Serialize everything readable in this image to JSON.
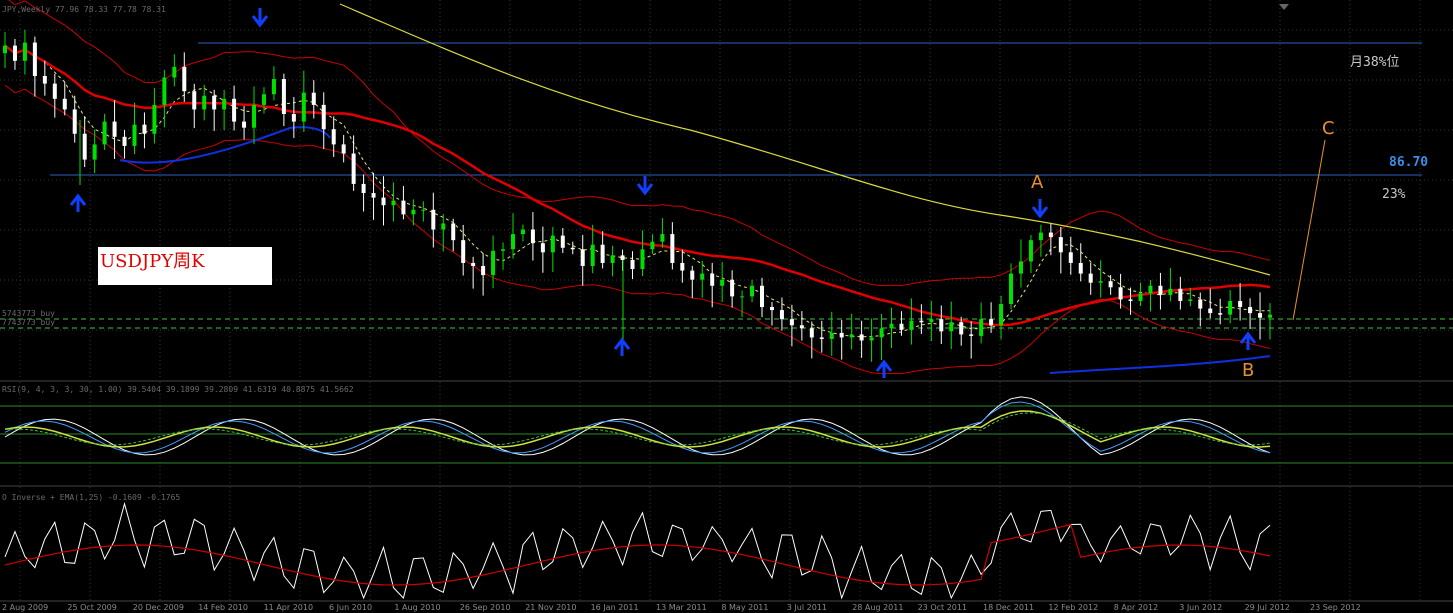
{
  "window": {
    "symbol_header": "JPY,Weekly  77.96 78.33 77.78 78.31"
  },
  "panes": {
    "main": {
      "level_label_1": "5743773 buy",
      "level_label_2": "7743773 buy"
    },
    "rsi": {
      "label": "RSI(9, 4, 3, 3, 30, 1.00) 39.5404 39.1899 39.2809 41.6319 40.8875 41.5662"
    },
    "osc": {
      "label": "O Inverse + EMA(1,25) -0.1609 -0.1765"
    }
  },
  "title_box": "USDJPY周K",
  "annotations": {
    "A": "A",
    "B": "B",
    "C": "C",
    "level_38": "月38%位",
    "level_8670": "86.70",
    "level_23": "23%"
  },
  "colors": {
    "bull": "#00e000",
    "bear": "#ffffff",
    "ma_red": "#e00000",
    "ma_blue": "#1030e0",
    "ma_yellow": "#d8d840",
    "band": "#cc0000",
    "level_line": "#3060c0",
    "dashed_green": "#40c040",
    "arrow": "#1040ff",
    "anno": "#e8902a"
  },
  "chart_data": [
    {
      "type": "candlestick",
      "title": "",
      "xlabel": "",
      "ylabel": "",
      "x_ticks": [
        "2 Aug 2009",
        "25 Oct 2009",
        "20 Dec 2009",
        "14 Feb 2010",
        "11 Apr 2010",
        "6 Jun 2010",
        "1 Aug 2010",
        "26 Sep 2010",
        "21 Nov 2010",
        "16 Jan 2011",
        "13 Mar 2011",
        "8 May 2011",
        "3 Jul 2011",
        "28 Aug 2011",
        "23 Oct 2011",
        "18 Dec 2011",
        "12 Feb 2012",
        "8 Apr 2012",
        "3 Jun 2012",
        "29 Jul 2012",
        "23 Sep 2012"
      ],
      "close": [
        96,
        95,
        96.2,
        94,
        93.5,
        92.5,
        91.8,
        90.2,
        88.5,
        89.5,
        91,
        90,
        89.4,
        90.8,
        90.2,
        92.1,
        93.9,
        94.6,
        93,
        91.8,
        92.7,
        91.8,
        92.5,
        91,
        90.6,
        92.1,
        92.8,
        93.8,
        91.5,
        91,
        92.9,
        92.1,
        90.5,
        89.5,
        88.9,
        86.9,
        86.3,
        86,
        85.5,
        85.8,
        84.9,
        85.2,
        85.2,
        83.9,
        84.3,
        83.2,
        81.7,
        81.5,
        80.9,
        82.5,
        82.6,
        83.6,
        83.9,
        83,
        82.4,
        83.5,
        82.7,
        82.6,
        81.5,
        82.9,
        81.7,
        82.2,
        81.9,
        81.3,
        82.6,
        83.1,
        83.6,
        81.7,
        81.2,
        80.6,
        81,
        80.2,
        80.6,
        79.5,
        79.5,
        80.2,
        78.8,
        78.6,
        78,
        77.6,
        77.4,
        76.8,
        76.7,
        77.1,
        76.8,
        77,
        76.6,
        76.8,
        77.4,
        77.7,
        77.3,
        77.9,
        77.8,
        78,
        77.2,
        77.8,
        77,
        76.9,
        78,
        77.6,
        79,
        81,
        81.8,
        83.2,
        83.7,
        83.4,
        82.4,
        81.7,
        81,
        80.4,
        80.5,
        80.1,
        79.3,
        79.2,
        79.7,
        80.2,
        79.6,
        80,
        79.2,
        79.3,
        78.7,
        78.4,
        78.3,
        79.2,
        78.8,
        78.4,
        78.1,
        78.3
      ],
      "open": [
        95.5,
        96,
        95,
        96.2,
        94,
        93.5,
        92.5,
        91.8,
        90.2,
        88.5,
        89.5,
        91,
        90,
        89.4,
        90.8,
        90.2,
        92.1,
        93.9,
        94.6,
        93,
        91.8,
        92.7,
        91.8,
        92.5,
        91,
        90.6,
        92.1,
        92.8,
        93.8,
        91.5,
        91,
        92.9,
        92.1,
        90.5,
        89.5,
        88.9,
        86.9,
        86.3,
        86,
        85.5,
        85.8,
        84.9,
        85.2,
        85.2,
        83.9,
        84.3,
        83.2,
        81.7,
        81.5,
        80.9,
        82.5,
        82.6,
        83.6,
        83.9,
        83,
        82.4,
        83.5,
        82.7,
        82.6,
        81.5,
        82.9,
        81.7,
        82.2,
        81.9,
        81.3,
        82.6,
        83.1,
        83.6,
        81.7,
        81.2,
        80.6,
        81,
        80.2,
        80.6,
        79.5,
        79.5,
        80.2,
        78.8,
        78.6,
        78,
        77.6,
        77.4,
        76.8,
        76.7,
        77.1,
        76.8,
        77,
        76.6,
        76.8,
        77.4,
        77.7,
        77.3,
        77.9,
        77.8,
        78,
        77.2,
        77.8,
        77,
        76.9,
        78,
        77.6,
        79,
        81,
        81.8,
        83.2,
        83.7,
        83.4,
        82.4,
        81.7,
        81,
        80.4,
        80.5,
        80.1,
        79.3,
        79.2,
        79.7,
        80.2,
        79.6,
        80,
        79.2,
        79.3,
        78.7,
        78.4,
        78.3,
        79.2,
        78.8,
        78.4,
        78.1
      ],
      "ylim": [
        74,
        99
      ],
      "indicators": [
        "moving-average-red",
        "moving-average-blue",
        "moving-average-yellow",
        "envelope-bands",
        "horizontal-levels"
      ]
    },
    {
      "type": "line",
      "title": "",
      "ylim": [
        0,
        100
      ]
    },
    {
      "type": "line",
      "title": "",
      "ylim": [
        -1,
        1
      ]
    }
  ]
}
